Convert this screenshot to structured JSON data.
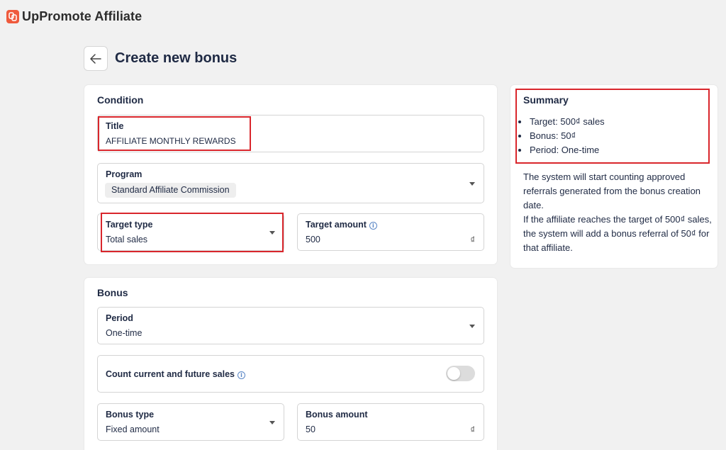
{
  "brand": {
    "name": "UpPromote Affiliate",
    "logo_color": "#ef5a3c"
  },
  "header": {
    "title": "Create new bonus",
    "back_icon": "arrow-left-icon"
  },
  "condition": {
    "heading": "Condition",
    "title_field": {
      "label": "Title",
      "value": "AFFILIATE MONTHLY REWARDS"
    },
    "program_field": {
      "label": "Program",
      "value": "Standard Affiliate Commission"
    },
    "target_type_field": {
      "label": "Target type",
      "value": "Total sales"
    },
    "target_amount_field": {
      "label": "Target amount",
      "value": "500",
      "suffix": "₫"
    }
  },
  "bonus": {
    "heading": "Bonus",
    "period_field": {
      "label": "Period",
      "value": "One-time"
    },
    "count_sales": {
      "label": "Count current and future sales",
      "enabled": false
    },
    "bonus_type_field": {
      "label": "Bonus type",
      "value": "Fixed amount"
    },
    "bonus_amount_field": {
      "label": "Bonus amount",
      "value": "50",
      "suffix": "₫"
    }
  },
  "summary": {
    "heading": "Summary",
    "items": [
      "Target: 500₫ sales",
      "Bonus: 50₫",
      "Period: One-time"
    ],
    "description_1": "The system will start counting approved referrals generated from the bonus creation date.",
    "description_2": "If the affiliate reaches the target of 500₫ sales, the system will add a bonus referral of 50₫ for that affiliate."
  },
  "colors": {
    "highlight": "#d9262c",
    "text": "#1f2a44",
    "background": "#f1f1f1",
    "info": "#5a86c6"
  }
}
